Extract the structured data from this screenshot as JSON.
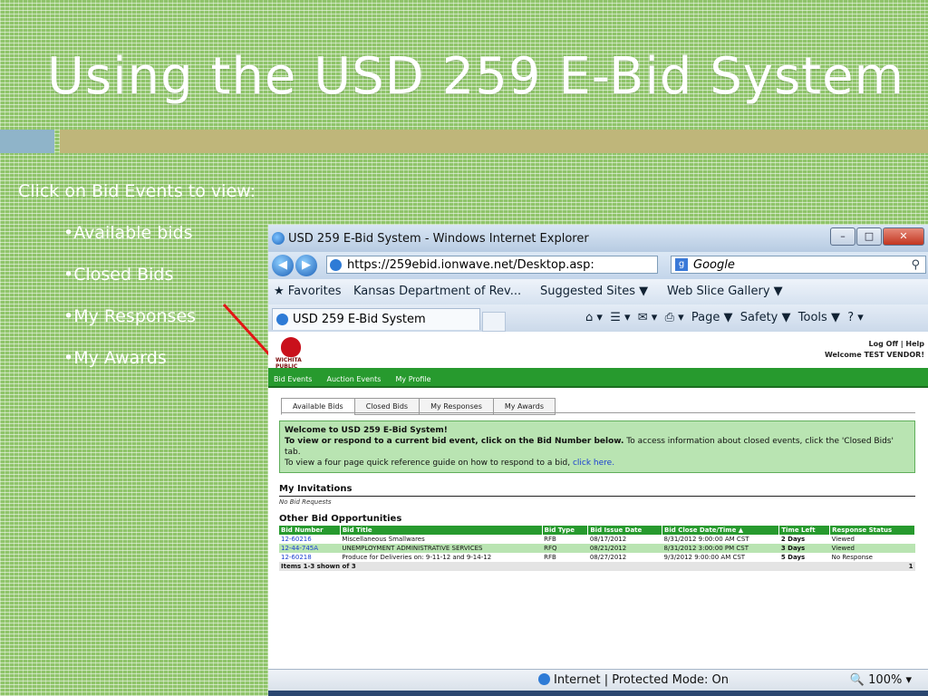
{
  "slide": {
    "title": "Using the USD 259 E-Bid System",
    "lead": "Click on Bid Events to view:",
    "bullets": [
      "•Available bids",
      "•Closed Bids",
      "•My Responses",
      "•My Awards"
    ]
  },
  "browser": {
    "window_title": "USD 259 E-Bid System - Windows Internet Explorer",
    "address": "https://259ebid.ionwave.net/Desktop.asp:",
    "search_placeholder": "Google",
    "favorites_label": "Favorites",
    "fav_items": [
      "Kansas Department of Rev...",
      "Suggested Sites ▼",
      "Web Slice Gallery ▼"
    ],
    "tab_title": "USD 259 E-Bid System",
    "commands": [
      "Page ▼",
      "Safety ▼",
      "Tools ▼"
    ],
    "status_text": "Internet | Protected Mode: On",
    "zoom": "100%"
  },
  "site": {
    "logo_text": "WICHITA PUBLIC SCHOOLS",
    "top_links": "Log Off | Help",
    "welcome_user": "Welcome TEST VENDOR!",
    "nav": [
      "Bid Events",
      "Auction Events",
      "My Profile"
    ],
    "tabs": [
      "Available Bids",
      "Closed Bids",
      "My Responses",
      "My Awards"
    ],
    "welcome_box": {
      "heading": "Welcome to USD 259 E-Bid System!",
      "line1_bold": "To view or respond to a current bid event, click on the Bid Number below.",
      "line1_rest": " To access information about closed events, click the 'Closed Bids' tab.",
      "line2": "To view a four page quick reference guide on how to respond to a bid, ",
      "line2_link": "click here."
    },
    "invitations_title": "My Invitations",
    "no_requests": "No Bid Requests",
    "opportunities_title": "Other Bid Opportunities",
    "columns": [
      "Bid Number",
      "Bid Title",
      "Bid Type",
      "Bid Issue Date",
      "Bid Close Date/Time ▲",
      "Time Left",
      "Response Status"
    ],
    "rows": [
      [
        "12-60216",
        "Miscellaneous Smallwares",
        "RFB",
        "08/17/2012",
        "8/31/2012 9:00:00 AM CST",
        "2 Days",
        "Viewed"
      ],
      [
        "12-44-745A",
        "UNEMPLOYMENT ADMINISTRATIVE SERVICES",
        "RFQ",
        "08/21/2012",
        "8/31/2012 3:00:00 PM CST",
        "3 Days",
        "Viewed"
      ],
      [
        "12-60218",
        "Produce for Deliveries on: 9-11-12 and 9-14-12",
        "RFB",
        "08/27/2012",
        "9/3/2012 9:00:00 AM CST",
        "5 Days",
        "No Response"
      ]
    ],
    "footer_left": "Items 1-3 shown of 3",
    "footer_right": "1"
  }
}
